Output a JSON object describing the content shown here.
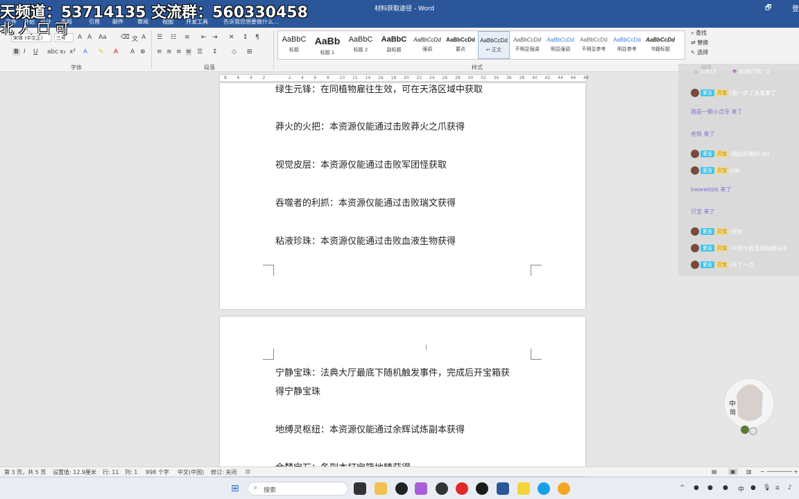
{
  "window": {
    "title": "材料获取途径 - Word",
    "controls": {
      "restore": "🗗",
      "user": "登"
    }
  },
  "overlay": {
    "banner_line1": "天频道：53714135 交流群：560330458",
    "banner_line2": "北 人 口 可"
  },
  "ribbon": {
    "tabs": [
      "文件",
      "开始",
      "设计",
      "布局",
      "引用",
      "邮件",
      "审阅",
      "视图",
      "开发工具"
    ],
    "tell_me": "告诉我您想要做什么...",
    "font_name": "宋体 (中文正)",
    "font_size": "三号",
    "group_labels": {
      "font": "字体",
      "paragraph": "段落",
      "styles": "样式",
      "editing": "编辑"
    },
    "styles": [
      {
        "sample": "AaBbC",
        "name": "标题",
        "size": "normal"
      },
      {
        "sample": "AaBb",
        "name": "标题 1",
        "size": "big"
      },
      {
        "sample": "AaBbC",
        "name": "标题 2",
        "size": "normal"
      },
      {
        "sample": "AaBbC",
        "name": "副标题",
        "size": "normal"
      },
      {
        "sample": "AaBbCcDd",
        "name": "强调",
        "size": "small"
      },
      {
        "sample": "AaBbCcDd",
        "name": "要点",
        "size": "small"
      },
      {
        "sample": "AaBbCcDd",
        "name": "↵ 正文",
        "size": "small"
      },
      {
        "sample": "AaBbCcDd",
        "name": "不明显强调",
        "size": "small"
      },
      {
        "sample": "AaBbCcDd",
        "name": "明显强调",
        "size": "small"
      },
      {
        "sample": "AaBbCcDd",
        "name": "不明显参考",
        "size": "small"
      },
      {
        "sample": "AaBbCcDd",
        "name": "明显参考",
        "size": "small"
      },
      {
        "sample": "AaBbCcDd",
        "name": "书籍标题",
        "size": "small"
      }
    ],
    "editing": [
      "查找",
      "替换",
      "选择"
    ]
  },
  "ruler": {
    "ticks": [
      "8",
      "6",
      "4",
      "2",
      "",
      "2",
      "4",
      "6",
      "8",
      "10",
      "12",
      "14",
      "16",
      "18",
      "20",
      "22",
      "24",
      "26",
      "28",
      "30",
      "32",
      "34",
      "36",
      "38",
      "40",
      "42",
      "44",
      "46",
      "48"
    ]
  },
  "document": {
    "page1_lines": [
      "绿生元锋：在同植物雇往生效，可在天洛区域中获取",
      "莽火的火把：本资源仅能通过击败莽火之爪获得",
      "视觉皮层：本资源仅能通过击败军团怪获取",
      "吞噬者的利抓：本资源仅能通过击败瑞文获得",
      "粘液珍珠：本资源仅能通过击败血液生物获得"
    ],
    "page2_lines": [
      "宁静宝珠：法典大厅最底下随机触发事件，完成后开宝箱获",
      "得宁静宝珠",
      "地缚灵枢纽：本资源仅能通过余辉试炼副本获得",
      "余梦宝石：各副本打宝箱地精获得"
    ]
  },
  "chat": {
    "header": "5/815",
    "header2": "本场订阅：0",
    "rows": [
      {
        "badge": "爱吉",
        "badge2": "贝宝",
        "msg": "(我一步了头发来了"
      },
      {
        "text": "我是一颗小点牙 来了"
      },
      {
        "text": "老铁 来了"
      },
      {
        "badge": "爱吉",
        "badge2": "贝宝",
        "msg": "(我好厉害的  (6)"
      },
      {
        "badge": "爱吉",
        "badge2": "贝宝",
        "msg": "(OK"
      },
      {
        "text": "bwwwbbb 来了"
      },
      {
        "text": "贝宝 来了"
      },
      {
        "badge": "爱吉",
        "badge2": "贝宝",
        "msg": "(安好"
      },
      {
        "badge": "爱吉",
        "badge2": "贝宝",
        "msg": "(中国十四五规划建设中"
      },
      {
        "badge": "爱吉",
        "badge2": "贝宝",
        "msg": "(开了一点"
      }
    ]
  },
  "mascot": {
    "label1": "中",
    "label2": "简"
  },
  "status": {
    "page": "第 3 页，共 5 页",
    "position": "设置值: 12.9厘米",
    "row": "行: 11",
    "col": "列: 1",
    "words": "998 个字",
    "lang": "中文(中国)",
    "track": "修订: 关闭"
  },
  "taskbar": {
    "search": "搜索",
    "time": "中"
  }
}
